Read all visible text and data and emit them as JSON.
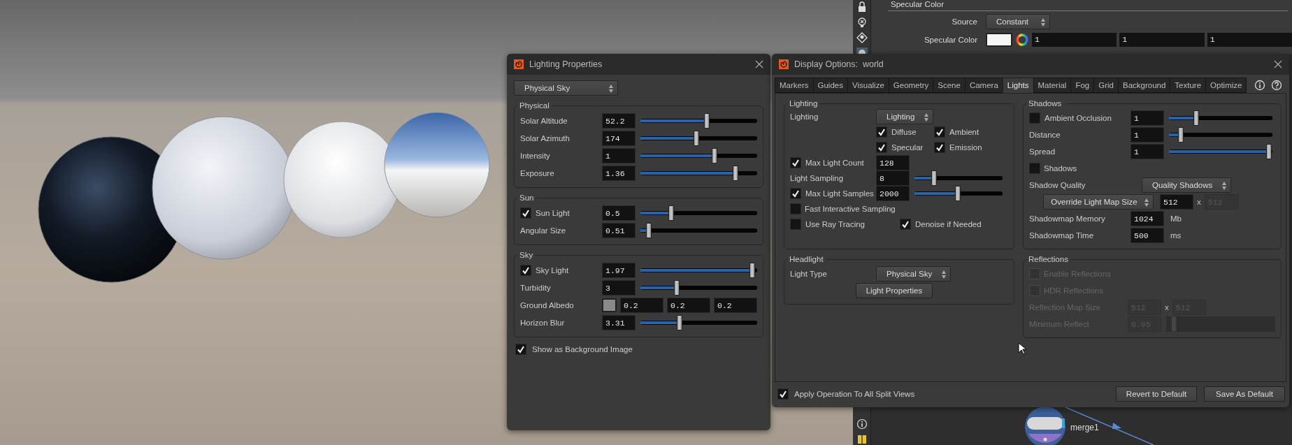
{
  "parameter_pane": {
    "section_title": "Specular Color",
    "rows": [
      {
        "kind": "dropdown",
        "label": "Source",
        "value": "Constant"
      },
      {
        "kind": "color",
        "label": "Specular Color",
        "values": [
          "1",
          "1",
          "1"
        ]
      }
    ]
  },
  "network": {
    "node_label": "merge1"
  },
  "lighting_properties": {
    "title": "Lighting Properties",
    "preset": "Physical Sky",
    "groups": [
      {
        "title": "Physical",
        "rows": [
          {
            "kind": "slider",
            "label": "Solar Altitude",
            "value": "52.2",
            "level": 0.57
          },
          {
            "kind": "slider",
            "label": "Solar Azimuth",
            "value": "174",
            "level": 0.48
          },
          {
            "kind": "slider",
            "label": "Intensity",
            "value": "1",
            "level": 0.64
          },
          {
            "kind": "slider",
            "label": "Exposure",
            "value": "1.36",
            "level": 0.83
          }
        ]
      },
      {
        "title": "Sun",
        "rows": [
          {
            "kind": "slider",
            "label": "Sun Light",
            "checked": true,
            "value": "0.5",
            "level": 0.25
          },
          {
            "kind": "slider",
            "label": "Angular Size",
            "value": "0.51",
            "level": 0.05
          }
        ]
      },
      {
        "title": "Sky",
        "rows": [
          {
            "kind": "slider",
            "label": "Sky Light",
            "checked": true,
            "value": "1.97",
            "level": 0.98
          },
          {
            "kind": "slider",
            "label": "Turbidity",
            "value": "3",
            "level": 0.3
          },
          {
            "kind": "color3",
            "label": "Ground Albedo",
            "values": [
              "0.2",
              "0.2",
              "0.2"
            ]
          },
          {
            "kind": "slider",
            "label": "Horizon Blur",
            "value": "3.31",
            "level": 0.33
          }
        ]
      }
    ],
    "show_background": {
      "label": "Show as Background Image",
      "checked": true
    }
  },
  "display_options": {
    "title": "Display Options:  world",
    "tabs": [
      {
        "label": "Markers",
        "selected": false
      },
      {
        "label": "Guides",
        "selected": false
      },
      {
        "label": "Visualize",
        "selected": false
      },
      {
        "label": "Geometry",
        "selected": false
      },
      {
        "label": "Scene",
        "selected": false
      },
      {
        "label": "Camera",
        "selected": false
      },
      {
        "label": "Lights",
        "selected": true
      },
      {
        "label": "Material",
        "selected": false
      },
      {
        "label": "Fog",
        "selected": false
      },
      {
        "label": "Grid",
        "selected": false
      },
      {
        "label": "Background",
        "selected": false
      },
      {
        "label": "Texture",
        "selected": false
      },
      {
        "label": "Optimize",
        "selected": false
      }
    ],
    "groups": [
      {
        "title": "Lighting",
        "disabled": false,
        "rows": [
          {
            "kind": "dropdown",
            "label": "Lighting",
            "value": "Lighting"
          },
          {
            "kind": "checks",
            "items": [
              {
                "label": "Diffuse",
                "checked": true
              },
              {
                "label": "Ambient",
                "checked": true
              }
            ]
          },
          {
            "kind": "checks",
            "items": [
              {
                "label": "Specular",
                "checked": true
              },
              {
                "label": "Emission",
                "checked": true
              }
            ]
          },
          {
            "kind": "field",
            "label": "Max Light Count",
            "checked": true,
            "value": "128"
          },
          {
            "kind": "slider",
            "label": "Light Sampling",
            "value": "8",
            "level": 0.2
          },
          {
            "kind": "slider",
            "label": "Max Light Samples",
            "checked": true,
            "value": "2000",
            "level": 0.49
          },
          {
            "kind": "check",
            "label": "Fast Interactive Sampling",
            "checked": false
          },
          {
            "kind": "check_pair",
            "items": [
              {
                "label": "Use Ray Tracing",
                "checked": false
              },
              {
                "label": "Denoise if Needed",
                "checked": true
              }
            ]
          }
        ]
      },
      {
        "title": "Shadows",
        "disabled": false,
        "rows": [
          {
            "kind": "slider",
            "label": "Ambient Occlusion",
            "checked": false,
            "value": "1",
            "level": 0.25
          },
          {
            "kind": "slider",
            "label": "Distance",
            "value": "1",
            "level": 0.09
          },
          {
            "kind": "slider",
            "label": "Spread",
            "value": "1",
            "level": 0.99
          },
          {
            "kind": "check",
            "label": "Shadows",
            "checked": false
          },
          {
            "kind": "dropdown",
            "label": "Shadow Quality",
            "value": "Quality Shadows"
          },
          {
            "kind": "size",
            "dropdown": "Override Light Map Size",
            "value": "512",
            "separator": "x",
            "value_2": "512",
            "value_2_disabled": true
          },
          {
            "kind": "field",
            "label": "Shadowmap Memory",
            "value": "1024",
            "unit": "Mb"
          },
          {
            "kind": "field",
            "label": "Shadowmap Time",
            "value": "500",
            "unit": "ms"
          }
        ]
      },
      {
        "title": "Headlight",
        "disabled": false,
        "rows": [
          {
            "kind": "dropdown",
            "label": "Light Type",
            "value": "Physical Sky"
          },
          {
            "kind": "button",
            "label": "Light Properties"
          }
        ]
      },
      {
        "title": "Reflections",
        "disabled": true,
        "rows": [
          {
            "kind": "check",
            "label": "Enable Reflections",
            "checked": false
          },
          {
            "kind": "check",
            "label": "HDR Reflections",
            "checked": false
          },
          {
            "kind": "size",
            "label": "Reflection Map Size",
            "value": "512",
            "separator": "x",
            "value_2": "512"
          },
          {
            "kind": "slider",
            "label": "Minimum Reflect",
            "value": "0.05",
            "level": 0.05
          }
        ]
      }
    ],
    "apply_all": {
      "label": "Apply Operation To All Split Views",
      "checked": true
    },
    "buttons": [
      "Revert to Default",
      "Save As Default"
    ]
  }
}
